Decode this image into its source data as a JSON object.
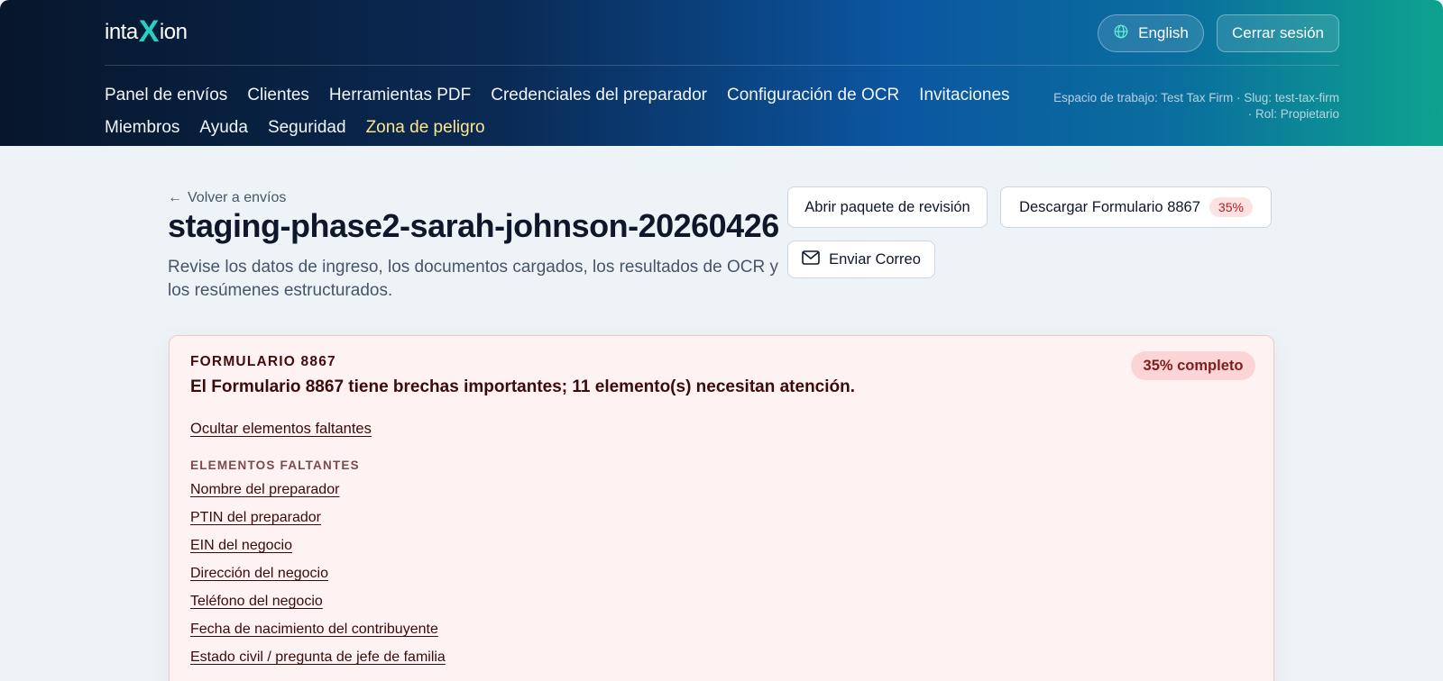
{
  "header": {
    "logo": {
      "pre": "inta",
      "x": "X",
      "post": "ion"
    },
    "language_label": "English",
    "logout_label": "Cerrar sesión",
    "nav_rows": [
      [
        "Panel de envíos",
        "Clientes",
        "Herramientas PDF",
        "Credenciales del preparador",
        "Configuración de OCR",
        "Invitaciones"
      ],
      [
        "Miembros",
        "Ayuda",
        "Seguridad",
        "Zona de peligro"
      ]
    ],
    "workspace_info": "Espacio de trabajo: Test Tax Firm · Slug: test-tax-firm · Rol: Propietario"
  },
  "main": {
    "back_link": "Volver a envíos",
    "title": "staging-phase2-sarah-johnson-20260426",
    "description": "Revise los datos de ingreso, los documentos cargados, los resultados de OCR y los resúmenes estructurados.",
    "buttons": {
      "review": "Abrir paquete de revisión",
      "download": "Descargar Formulario 8867",
      "download_badge": "35%",
      "email": "Enviar Correo"
    }
  },
  "form_panel": {
    "label": "FORMULARIO 8867",
    "heading": "El Formulario 8867 tiene brechas importantes; 11 elemento(s) necesitan atención.",
    "complete_badge": "35% completo",
    "toggle_link": "Ocultar elementos faltantes",
    "missing_label": "ELEMENTOS FALTANTES",
    "missing_items": [
      "Nombre del preparador",
      "PTIN del preparador",
      "EIN del negocio",
      "Dirección del negocio",
      "Teléfono del negocio",
      "Fecha de nacimiento del contribuyente",
      "Estado civil / pregunta de jefe de familia"
    ]
  },
  "colors": {
    "danger": "#b91c1c",
    "accent": "#22d3c5",
    "nav_danger": "#fde68a"
  },
  "icons": [
    "globe-icon",
    "arrow-left-icon",
    "mail-icon"
  ]
}
